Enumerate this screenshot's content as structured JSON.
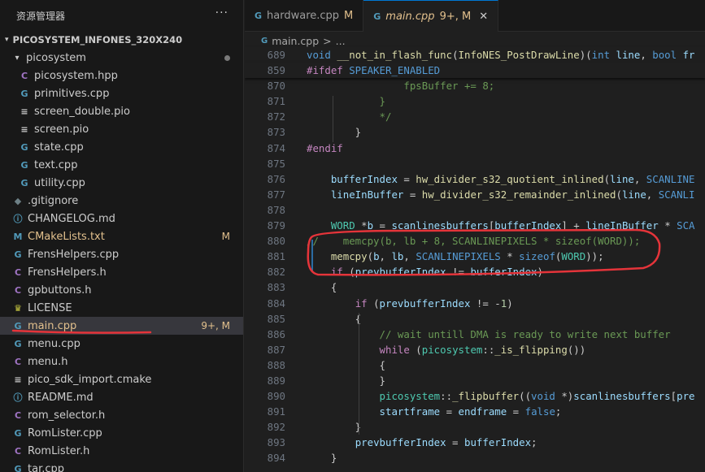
{
  "sidebar": {
    "title": "资源管理器",
    "more": "···",
    "project": "PICOSYSTEM_INFONES_320X240",
    "folder": {
      "name": "picosystem"
    },
    "folder_files": [
      {
        "name": "picosystem.hpp",
        "icon": "C",
        "color": "#a074c4"
      },
      {
        "name": "primitives.cpp",
        "icon": "G",
        "color": "#519aba"
      },
      {
        "name": "screen_double.pio",
        "icon": "≡",
        "color": "#cccccc"
      },
      {
        "name": "screen.pio",
        "icon": "≡",
        "color": "#cccccc"
      },
      {
        "name": "state.cpp",
        "icon": "G",
        "color": "#519aba"
      },
      {
        "name": "text.cpp",
        "icon": "G",
        "color": "#519aba"
      },
      {
        "name": "utility.cpp",
        "icon": "G",
        "color": "#519aba"
      }
    ],
    "root_files": [
      {
        "name": ".gitignore",
        "icon": "◆",
        "color": "#6d8086",
        "badge": ""
      },
      {
        "name": "CHANGELOG.md",
        "icon": "ⓘ",
        "color": "#519aba",
        "badge": ""
      },
      {
        "name": "CMakeLists.txt",
        "icon": "M",
        "color": "#519aba",
        "badge": "M"
      },
      {
        "name": "FrensHelpers.cpp",
        "icon": "G",
        "color": "#519aba",
        "badge": ""
      },
      {
        "name": "FrensHelpers.h",
        "icon": "C",
        "color": "#a074c4",
        "badge": ""
      },
      {
        "name": "gpbuttons.h",
        "icon": "C",
        "color": "#a074c4",
        "badge": ""
      },
      {
        "name": "LICENSE",
        "icon": "♛",
        "color": "#cbcb41",
        "badge": ""
      },
      {
        "name": "main.cpp",
        "icon": "G",
        "color": "#519aba",
        "badge": "9+, M",
        "active": true
      },
      {
        "name": "menu.cpp",
        "icon": "G",
        "color": "#519aba",
        "badge": ""
      },
      {
        "name": "menu.h",
        "icon": "C",
        "color": "#a074c4",
        "badge": ""
      },
      {
        "name": "pico_sdk_import.cmake",
        "icon": "≡",
        "color": "#cccccc",
        "badge": ""
      },
      {
        "name": "README.md",
        "icon": "ⓘ",
        "color": "#519aba",
        "badge": ""
      },
      {
        "name": "rom_selector.h",
        "icon": "C",
        "color": "#a074c4",
        "badge": ""
      },
      {
        "name": "RomLister.cpp",
        "icon": "G",
        "color": "#519aba",
        "badge": ""
      },
      {
        "name": "RomLister.h",
        "icon": "C",
        "color": "#a074c4",
        "badge": ""
      },
      {
        "name": "tar.cpp",
        "icon": "G",
        "color": "#519aba",
        "badge": ""
      }
    ]
  },
  "tabs": [
    {
      "label": "hardware.cpp",
      "status": "M",
      "icon": "G"
    },
    {
      "label": "main.cpp",
      "status": "9+, M",
      "icon": "G",
      "close": "✕",
      "active": true
    }
  ],
  "breadcrumb": {
    "file": "main.cpp",
    "sep": ">",
    "rest": "..."
  },
  "code_lines": [
    {
      "n": "689",
      "sticky": true,
      "tokens": [
        [
          "kw",
          "void "
        ],
        [
          "fn",
          "__not_in_flash_func"
        ],
        [
          "pn",
          "("
        ],
        [
          "fn",
          "InfoNES_PostDrawLine"
        ],
        [
          "pn",
          ")("
        ],
        [
          "kw",
          "int "
        ],
        [
          "va",
          "line"
        ],
        [
          "pn",
          ", "
        ],
        [
          "kw",
          "bool "
        ],
        [
          "va",
          "fr"
        ]
      ]
    },
    {
      "n": "859",
      "sticky": true,
      "tokens": [
        [
          "ct",
          "#ifdef "
        ],
        [
          "mac",
          "SPEAKER_ENABLED"
        ]
      ]
    },
    {
      "n": "870",
      "tokens": [
        [
          "cm",
          "                fpsBuffer += 8;"
        ]
      ]
    },
    {
      "n": "871",
      "tokens": [
        [
          "cm",
          "            }"
        ]
      ]
    },
    {
      "n": "872",
      "tokens": [
        [
          "cm",
          "            */"
        ]
      ]
    },
    {
      "n": "873",
      "tokens": [
        [
          "pn",
          "        }"
        ]
      ]
    },
    {
      "n": "874",
      "tokens": [
        [
          "ct",
          "#endif"
        ]
      ]
    },
    {
      "n": "875",
      "tokens": []
    },
    {
      "n": "876",
      "tokens": [
        [
          "pn",
          "    "
        ],
        [
          "va",
          "bufferIndex"
        ],
        [
          "pn",
          " = "
        ],
        [
          "fn",
          "hw_divider_s32_quotient_inlined"
        ],
        [
          "pn",
          "("
        ],
        [
          "va",
          "line"
        ],
        [
          "pn",
          ", "
        ],
        [
          "mac",
          "SCANLINE"
        ]
      ]
    },
    {
      "n": "877",
      "tokens": [
        [
          "pn",
          "    "
        ],
        [
          "va",
          "lineInBuffer"
        ],
        [
          "pn",
          " = "
        ],
        [
          "fn",
          "hw_divider_s32_remainder_inlined"
        ],
        [
          "pn",
          "("
        ],
        [
          "va",
          "line"
        ],
        [
          "pn",
          ", "
        ],
        [
          "mac",
          "SCANLI"
        ]
      ]
    },
    {
      "n": "878",
      "tokens": []
    },
    {
      "n": "879",
      "tokens": [
        [
          "pn",
          "    "
        ],
        [
          "ty",
          "WORD"
        ],
        [
          "pn",
          " *"
        ],
        [
          "va",
          "b"
        ],
        [
          "pn",
          " = "
        ],
        [
          "va",
          "scanlinesbuffers"
        ],
        [
          "pn",
          "["
        ],
        [
          "va",
          "bufferIndex"
        ],
        [
          "pn",
          "] + "
        ],
        [
          "va",
          "lineInBuffer"
        ],
        [
          "pn",
          " * "
        ],
        [
          "mac",
          "SCA"
        ]
      ]
    },
    {
      "n": "880",
      "tokens": [
        [
          "cm",
          "//    memcpy(b, lb + 8, SCANLINEPIXELS * sizeof(WORD));"
        ]
      ]
    },
    {
      "n": "881",
      "tokens": [
        [
          "pn",
          "    "
        ],
        [
          "fn",
          "memcpy"
        ],
        [
          "pn",
          "("
        ],
        [
          "va",
          "b"
        ],
        [
          "pn",
          ", "
        ],
        [
          "va",
          "lb"
        ],
        [
          "pn",
          ", "
        ],
        [
          "mac",
          "SCANLINEPIXELS"
        ],
        [
          "pn",
          " * "
        ],
        [
          "kw",
          "sizeof"
        ],
        [
          "pn",
          "("
        ],
        [
          "ty",
          "WORD"
        ],
        [
          "pn",
          "));"
        ]
      ]
    },
    {
      "n": "882",
      "tokens": [
        [
          "pn",
          "    "
        ],
        [
          "ct",
          "if"
        ],
        [
          "pn",
          " ("
        ],
        [
          "va",
          "prevbufferIndex"
        ],
        [
          "pn",
          " != "
        ],
        [
          "va",
          "bufferIndex"
        ],
        [
          "pn",
          ")"
        ]
      ]
    },
    {
      "n": "883",
      "tokens": [
        [
          "pn",
          "    {"
        ]
      ]
    },
    {
      "n": "884",
      "tokens": [
        [
          "pn",
          "        "
        ],
        [
          "ct",
          "if"
        ],
        [
          "pn",
          " ("
        ],
        [
          "va",
          "prevbufferIndex"
        ],
        [
          "pn",
          " != -"
        ],
        [
          "nm",
          "1"
        ],
        [
          "pn",
          ")"
        ]
      ]
    },
    {
      "n": "885",
      "tokens": [
        [
          "pn",
          "        {"
        ]
      ]
    },
    {
      "n": "886",
      "tokens": [
        [
          "pn",
          "            "
        ],
        [
          "cm",
          "// wait untill DMA is ready to write next buffer"
        ]
      ]
    },
    {
      "n": "887",
      "tokens": [
        [
          "pn",
          "            "
        ],
        [
          "ct",
          "while"
        ],
        [
          "pn",
          " ("
        ],
        [
          "ty",
          "picosystem"
        ],
        [
          "pn",
          "::"
        ],
        [
          "fn",
          "_is_flipping"
        ],
        [
          "pn",
          "())"
        ]
      ]
    },
    {
      "n": "888",
      "tokens": [
        [
          "pn",
          "            {"
        ]
      ]
    },
    {
      "n": "889",
      "tokens": [
        [
          "pn",
          "            }"
        ]
      ]
    },
    {
      "n": "890",
      "tokens": [
        [
          "pn",
          "            "
        ],
        [
          "ty",
          "picosystem"
        ],
        [
          "pn",
          "::"
        ],
        [
          "fn",
          "_flipbuffer"
        ],
        [
          "pn",
          "(("
        ],
        [
          "kw",
          "void"
        ],
        [
          "pn",
          " *)"
        ],
        [
          "va",
          "scanlinesbuffers"
        ],
        [
          "pn",
          "["
        ],
        [
          "va",
          "pre"
        ]
      ]
    },
    {
      "n": "891",
      "tokens": [
        [
          "pn",
          "            "
        ],
        [
          "va",
          "startframe"
        ],
        [
          "pn",
          " = "
        ],
        [
          "va",
          "endframe"
        ],
        [
          "pn",
          " = "
        ],
        [
          "kw",
          "false"
        ],
        [
          "pn",
          ";"
        ]
      ]
    },
    {
      "n": "892",
      "tokens": [
        [
          "pn",
          "        }"
        ]
      ]
    },
    {
      "n": "893",
      "tokens": [
        [
          "pn",
          "        "
        ],
        [
          "va",
          "prevbufferIndex"
        ],
        [
          "pn",
          " = "
        ],
        [
          "va",
          "bufferIndex"
        ],
        [
          "pn",
          ";"
        ]
      ]
    },
    {
      "n": "894",
      "tokens": [
        [
          "pn",
          "    }"
        ]
      ]
    }
  ],
  "colors": {
    "annotation": "#e5343a",
    "accent": "#0078d4",
    "modified": "#e2c08d"
  }
}
